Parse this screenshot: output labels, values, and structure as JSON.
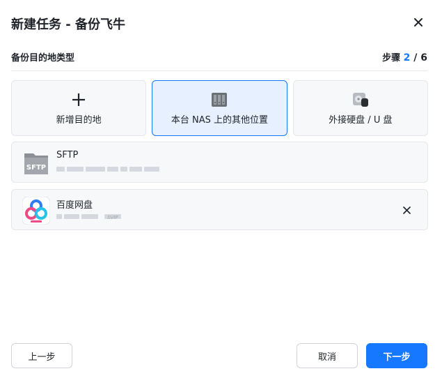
{
  "dialog": {
    "title": "新建任务 - 备份飞牛",
    "close_icon": "close-icon"
  },
  "section": {
    "label": "备份目的地类型",
    "step_prefix": "步骤",
    "step_current": "2",
    "step_separator": " / ",
    "step_total": "6"
  },
  "options": [
    {
      "label": "新增目的地",
      "icon": "plus-icon",
      "selected": false
    },
    {
      "label": "本台 NAS 上的其他位置",
      "icon": "nas-server-icon",
      "selected": true
    },
    {
      "label": "外接硬盘 / U 盘",
      "icon": "external-drive-icon",
      "selected": false
    }
  ],
  "destinations": [
    {
      "name": "SFTP",
      "icon": "sftp-icon",
      "thumb_text": "SFTP"
    },
    {
      "name": "百度网盘",
      "icon": "baidu-netdisk-icon",
      "tag": "SVIP"
    }
  ],
  "footer": {
    "prev_label": "上一步",
    "cancel_label": "取消",
    "next_label": "下一步"
  },
  "colors": {
    "accent": "#1677ff",
    "selected_bg": "#e6f0ff",
    "card_bg": "#f7f8fa",
    "border": "#e5e6eb"
  }
}
